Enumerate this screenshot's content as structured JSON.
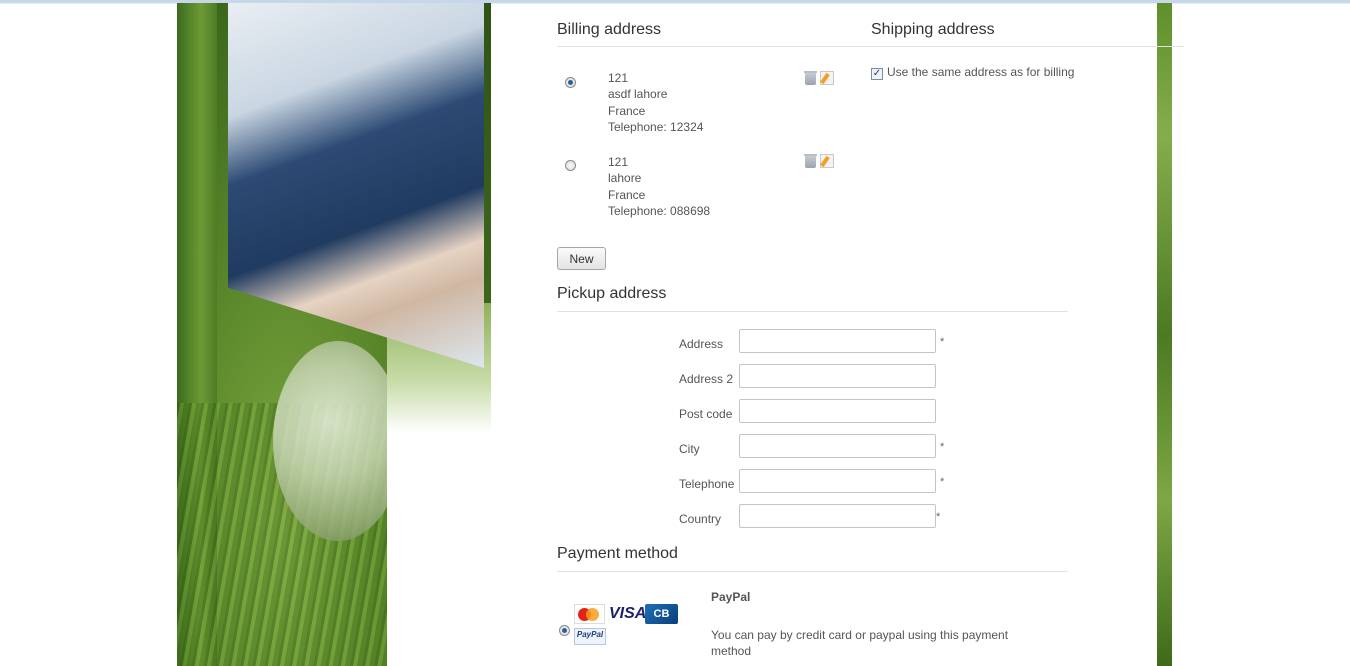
{
  "billing": {
    "title": "Billing address",
    "addresses": [
      {
        "line1": "121",
        "line2": "asdf lahore",
        "line3": "France",
        "line4": "Telephone: 12324",
        "selected": true
      },
      {
        "line1": "121",
        "line2": "lahore",
        "line3": "France",
        "line4": "Telephone: 088698",
        "selected": false
      }
    ],
    "new_button": "New"
  },
  "shipping": {
    "title": "Shipping address",
    "same_as_billing_label": "Use the same address as for billing",
    "same_as_billing_checked": true,
    "check_glyph": "✓"
  },
  "pickup": {
    "title": "Pickup address",
    "fields": [
      {
        "label": "Address",
        "value": "",
        "required": true
      },
      {
        "label": "Address 2",
        "value": "",
        "required": false
      },
      {
        "label": "Post code",
        "value": "",
        "required": false
      },
      {
        "label": "City",
        "value": "",
        "required": true
      },
      {
        "label": "Telephone",
        "value": "",
        "required": true
      },
      {
        "label": "Country",
        "value": "",
        "required": true
      }
    ],
    "required_mark": "*"
  },
  "payment": {
    "title": "Payment method",
    "methods": [
      {
        "name": "PayPal",
        "description": "You can pay by credit card or paypal using this payment method",
        "selected": true,
        "logos": {
          "mastercard": "mastercard-icon",
          "visa": "VISA",
          "cb": "CB",
          "paypal": "PayPal"
        }
      }
    ]
  },
  "icons": {
    "delete": "trash-icon",
    "edit": "edit-icon"
  },
  "colors": {
    "accent_green": "#5d8a2c",
    "radio_selected": "#2c5f9e"
  }
}
